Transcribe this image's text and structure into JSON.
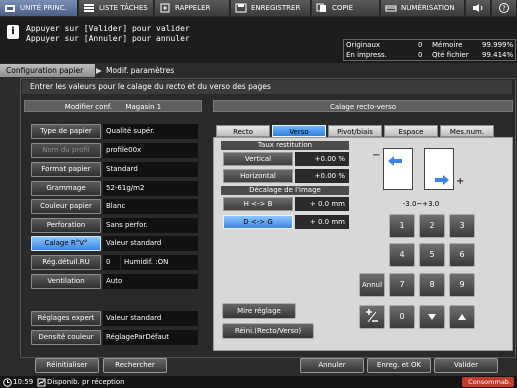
{
  "top_tabs": [
    {
      "label": "UNITÉ PRINC.",
      "active": true
    },
    {
      "label": "LISTE TÂCHES",
      "active": false
    },
    {
      "label": "RAPPELER",
      "active": false
    },
    {
      "label": "ENREGISTRER",
      "active": false
    },
    {
      "label": "COPIE",
      "active": false
    },
    {
      "label": "NUMÉRISATION",
      "active": false
    }
  ],
  "message": {
    "line1": "Appuyer sur [Valider] pour valider",
    "line2": "Appuyer sur [Annuler] pour annuler"
  },
  "counters": {
    "originaux_label": "Originaux",
    "originaux_value": "0",
    "memoire_label": "Mémoire",
    "memoire_value": "99.999%",
    "impress_label": "En impress.",
    "impress_value": "0",
    "qte_label": "Qté fichier",
    "qte_value": "99.414%"
  },
  "breadcrumb": {
    "item1": "Configuration papier",
    "item2": "Modif. paramètres"
  },
  "instruction": "Entrer les valeurs pour le calage du recto et du verso des pages",
  "left_header": {
    "title": "Modifier conf.",
    "tray": "Magasin 1"
  },
  "left_rows": [
    {
      "label": "Type de papier",
      "value": "Qualité supér."
    },
    {
      "label": "Nom du profil",
      "value": "profile00x"
    },
    {
      "label": "Format papier",
      "value": "Standard"
    },
    {
      "label": "Grammage",
      "value": "52-61g/m2"
    },
    {
      "label": "Couleur papier",
      "value": "Blanc"
    },
    {
      "label": "Perforation",
      "value": "Sans perfor."
    },
    {
      "label": "Calage R°V°",
      "value": "Valeur standard"
    },
    {
      "label": "Rég.détuil.RU",
      "value": "0",
      "extra": "Humidif. :ON"
    },
    {
      "label": "Ventilation",
      "value": "Auto"
    }
  ],
  "left_bottom_rows": [
    {
      "label": "Réglages expert",
      "value": "Valeur standard"
    },
    {
      "label": "Densité couleur",
      "value": "RéglageParDéfaut"
    }
  ],
  "right_header": "Calage recto-verso",
  "right_tabs": [
    "Recto",
    "Verso",
    "Pivot/biais",
    "Espace",
    "Mes.num."
  ],
  "active_right_tab": "Verso",
  "taux": {
    "title": "Taux restitution",
    "vertical_label": "Vertical",
    "vertical_value": "+0.00 %",
    "horizontal_label": "Horizontal",
    "horizontal_value": "+0.00 %"
  },
  "decalage": {
    "title": "Décalage de l'image",
    "hb_label": "H <-> B",
    "hb_value": "+ 0.0 mm",
    "dg_label": "D <-> G",
    "dg_value": "+ 0.0 mm"
  },
  "range_text": "-3.0~+3.0",
  "keypad": [
    "1",
    "2",
    "3",
    "4",
    "5",
    "6",
    "7",
    "8",
    "9"
  ],
  "keypad_extra": {
    "annul": "Annul",
    "zero": "0"
  },
  "mire_label": "Mire réglage",
  "reinit_label": "Réini.(Recto/Verso)",
  "bottom_buttons": {
    "reinitialiser": "Réinitialiser",
    "rechercher": "Rechercher",
    "annuler": "Annuler",
    "enreg_ok": "Enreg. et OK",
    "valider": "Valider"
  },
  "status": {
    "time": "10:59",
    "text": "Disponib. pr réception",
    "consumables": "Consommab."
  },
  "colors": {
    "accent_blue": "#3a86e0",
    "selected_blue": "#8ec6ff",
    "consumables_red": "#c0392b"
  }
}
